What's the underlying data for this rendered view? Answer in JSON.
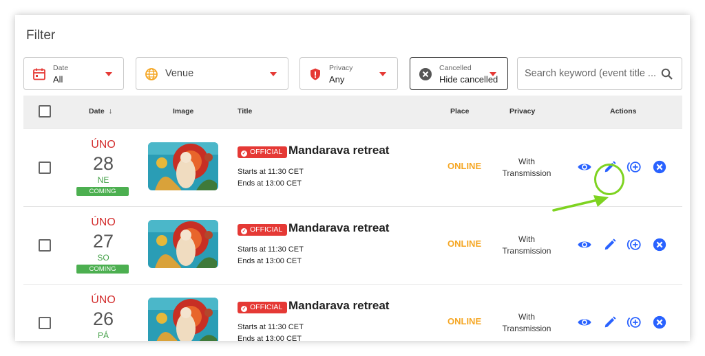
{
  "filter": {
    "title": "Filter",
    "date": {
      "label": "Date",
      "value": "All"
    },
    "venue": {
      "label": "Venue"
    },
    "privacy": {
      "label": "Privacy",
      "value": "Any"
    },
    "cancelled": {
      "label": "Cancelled",
      "value": "Hide cancelled"
    },
    "search": {
      "placeholder": "Search keyword (event title ..."
    }
  },
  "table": {
    "headers": {
      "date": "Date",
      "sort_indicator": "↓",
      "image": "Image",
      "title": "Title",
      "place": "Place",
      "privacy": "Privacy",
      "actions": "Actions"
    },
    "rows": [
      {
        "month": "ÚNO",
        "day": "28",
        "dow": "NE",
        "badge": "COMING",
        "tag": "OFFICIAL",
        "title": "Mandarava retreat",
        "start": "Starts at 11:30 CET",
        "end": "Ends at 13:00 CET",
        "place": "ONLINE",
        "privacy_line1": "With",
        "privacy_line2": "Transmission"
      },
      {
        "month": "ÚNO",
        "day": "27",
        "dow": "SO",
        "badge": "COMING",
        "tag": "OFFICIAL",
        "title": "Mandarava retreat",
        "start": "Starts at 11:30 CET",
        "end": "Ends at 13:00 CET",
        "place": "ONLINE",
        "privacy_line1": "With",
        "privacy_line2": "Transmission"
      },
      {
        "month": "ÚNO",
        "day": "26",
        "dow": "PÁ",
        "badge": "",
        "tag": "OFFICIAL",
        "title": "Mandarava retreat",
        "start": "Starts at 11:30 CET",
        "end": "Ends at 13:00 CET",
        "place": "ONLINE",
        "privacy_line1": "With",
        "privacy_line2": "Transmission"
      }
    ]
  },
  "actions": {
    "icons": [
      "eye-icon",
      "pencil-icon",
      "add-circle-icon",
      "cancel-circle-icon"
    ]
  },
  "colors": {
    "accent_red": "#e53935",
    "online_orange": "#f5a623",
    "action_blue": "#2962ff",
    "badge_green": "#4caf50",
    "highlight_green": "#7ed321"
  }
}
